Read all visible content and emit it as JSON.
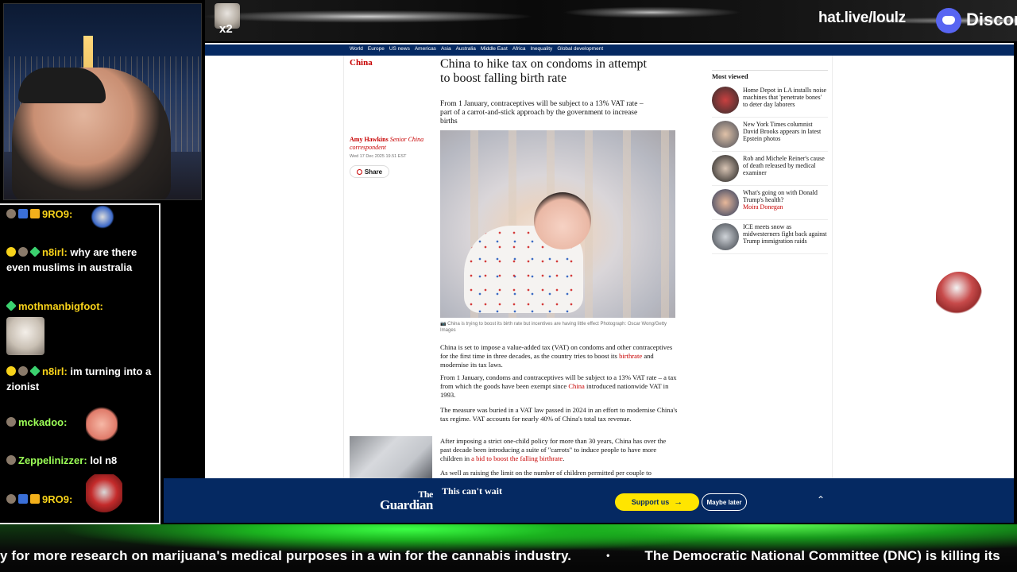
{
  "overlay": {
    "emote_multiplier": "x2",
    "hat_url": "hat.live/loulz",
    "discord_label": "Discor"
  },
  "chat": {
    "messages": [
      {
        "user": "9RO9:",
        "text": ""
      },
      {
        "user": "n8irl:",
        "text": "why are there even muslims in australia"
      },
      {
        "user": "mothmanbigfoot:",
        "text": ""
      },
      {
        "user": "n8irl:",
        "text": "im turning into a zionist"
      },
      {
        "user": "mckadoo:",
        "text": ""
      },
      {
        "user": "Zeppelinizzer:",
        "text": "lol n8"
      },
      {
        "user": "9RO9:",
        "text": ""
      }
    ]
  },
  "article": {
    "nav": [
      "World",
      "Europe",
      "US news",
      "Americas",
      "Asia",
      "Australia",
      "Middle East",
      "Africa",
      "Inequality",
      "Global development"
    ],
    "section": "China",
    "headline": "China to hike tax on condoms in attempt to boost falling birth rate",
    "standfirst": "From 1 January, contraceptives will be subject to a 13% VAT rate – part of a carrot-and-stick approach by the government to increase births",
    "author": "Amy Hawkins",
    "author_role": "Senior China correspondent",
    "date": "Wed 17 Dec 2025 19.51 EST",
    "share": "Share",
    "caption": "China is trying to boost its birth rate but incentives are having little effect Photograph: Oscar Wong/Getty Images",
    "p1a": "China is set to impose a value-added tax (VAT) on condoms and other contraceptives for the first time in three decades, as the country tries to boost its ",
    "p1link": "birthrate",
    "p1b": " and modernise its tax laws.",
    "p2a": "From 1 January, condoms and contraceptives will be subject to a 13% VAT rate – a tax from which the goods have been exempt since ",
    "p2link": "China",
    "p2b": " introduced nationwide VAT in 1993.",
    "p3": "The measure was buried in a VAT law passed in 2024 in an effort to modernise China's tax regime. VAT accounts for nearly 40% of China's total tax revenue.",
    "p4a": "After imposing a strict one-child policy for more than 30 years, China has over the past decade been introducing a suite of \"carrots\" to induce people to have more children in ",
    "p4link": "a bid to boost the falling birthrate",
    "p4b": ".",
    "p5": "As well as raising the limit on the number of children permitted per couple to"
  },
  "most_viewed": {
    "title": "Most viewed",
    "items": [
      {
        "text": "Home Depot in LA installs noise machines that 'penetrate bones' to deter day laborers",
        "author": ""
      },
      {
        "text": "New York Times columnist David Brooks appears in latest Epstein photos",
        "author": ""
      },
      {
        "text": "Rob and Michele Reiner's cause of death released by medical examiner",
        "author": ""
      },
      {
        "text": "What's going on with Donald Trump's health?",
        "author": "Moira Donegan"
      },
      {
        "text": "ICE meets snow as midwesterners fight back against Trump immigration raids",
        "author": ""
      }
    ]
  },
  "guardian_banner": {
    "logo_line1": "The",
    "logo_line2": "Guardian",
    "cta": "This can't wait",
    "support": "Support us",
    "maybe_later": "Maybe later"
  },
  "ticker": {
    "item1": "y for more research on marijuana's medical purposes in a win for the cannabis industry.",
    "separator": "•",
    "item2": "The Democratic National Committee (DNC) is killing its"
  },
  "colors": {
    "guardian_blue": "#052962",
    "guardian_red": "#c70000",
    "support_yellow": "#ffe500",
    "chat_username": "#9cff57"
  }
}
